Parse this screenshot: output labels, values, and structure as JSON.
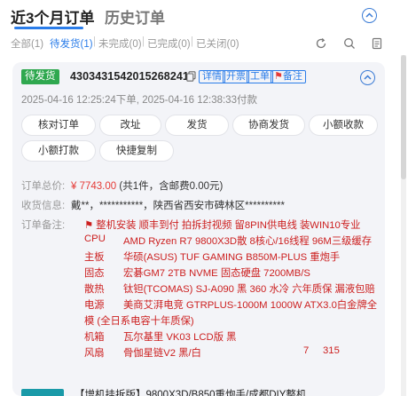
{
  "tabs": {
    "active": "近3个月订单",
    "inactive": "历史订单"
  },
  "filters": [
    {
      "label": "全部(1)",
      "active": false
    },
    {
      "label": "待发货(1)",
      "active": true
    },
    {
      "label": "未完成(0)",
      "active": false
    },
    {
      "label": "已完成(0)",
      "active": false
    },
    {
      "label": "已关闭(0)",
      "active": false
    }
  ],
  "filter_sep": "|",
  "order": {
    "status": "待发货",
    "id": "4303431542015268241",
    "links": {
      "detail": "详情",
      "invoice": "开票",
      "ticket": "工单",
      "note": "备注",
      "note_flag": "⚑"
    },
    "created_time": "2025-04-16 12:25:24下单",
    "paid_time": "2025-04-16 12:38:33付款",
    "actions": [
      "核对订单",
      "改址",
      "发货",
      "协商发货",
      "小额收款",
      "小额打款",
      "快捷复制"
    ],
    "total_label": "订单总价:",
    "total_price": "¥ 7743.00",
    "total_detail": "(共1件，含邮费0.00元)",
    "receiver_label": "收货信息:",
    "receiver_value": "戴**，***********，陕西省西安市碑林区**********",
    "note_label": "订单备注:",
    "note_flag": "⚑",
    "note_first": "整机安装 顺丰到付 拍拆封视频 留8PIN供电线 装WIN10专业",
    "specs": [
      {
        "key": "CPU",
        "value": "AMD Ryzen R7 9800X3D散 8核心/16线程 96M三级缓存"
      },
      {
        "key": "主板",
        "value": "华硕(ASUS) TUF GAMING B850M-PLUS 重炮手"
      },
      {
        "key": "固态",
        "value": "宏碁GM7 2TB  NVME 固态硬盘  7200MB/S"
      },
      {
        "key": "散热",
        "value": "钛钽(TCOMAS) SJ-A090 黑 360 水冷 六年质保 漏液包赔"
      },
      {
        "key": "电源",
        "value": "美商艾湃电竞 GTRPLUS-1000M 1000W ATX3.0白金牌全"
      },
      {
        "key": "机箱",
        "value": "瓦尔基里 VK03 LCD版 黑"
      },
      {
        "key": "风扇",
        "value": "骨伽星链V2 黑/白"
      }
    ],
    "power_cont": "模  (全日系电容十年质保)",
    "fan_qty": "7",
    "fan_price": "315"
  },
  "next_order": {
    "title": "【增机挂拆版】9800X3D/B850重炮手/成都DIY整机"
  },
  "colors": {
    "accent": "#2b7de9",
    "status_green": "#2fa84f",
    "price_red": "#e53935",
    "note_red": "#cc1f1f",
    "card_bg": "#f3f4f8"
  },
  "icons": [
    "refresh-icon",
    "search-icon",
    "document-icon",
    "copy-icon",
    "chevron-up-icon",
    "flag-icon"
  ]
}
